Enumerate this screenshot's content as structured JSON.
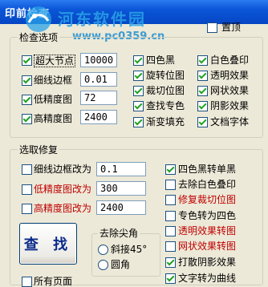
{
  "window": {
    "title": "印前检查"
  },
  "watermark": {
    "name": "河东软件园",
    "url": "www.pc0359.cn"
  },
  "top": {
    "pin_label": "置顶",
    "pin_checked": false
  },
  "check_group": {
    "title": "检查选项",
    "left": [
      {
        "label": "超大节点",
        "checked": true,
        "value": "10000"
      },
      {
        "label": "细线边框",
        "checked": true,
        "value": "0.01"
      },
      {
        "label": "低精度图",
        "checked": true,
        "value": "72"
      },
      {
        "label": "高精度图",
        "checked": true,
        "value": "2400"
      }
    ],
    "middle": [
      {
        "label": "四色黑",
        "checked": true
      },
      {
        "label": "旋转位图",
        "checked": true
      },
      {
        "label": "裁切位图",
        "checked": true
      },
      {
        "label": "查找专色",
        "checked": true
      },
      {
        "label": "渐变填充",
        "checked": true
      }
    ],
    "right": [
      {
        "label": "白色叠印",
        "checked": true
      },
      {
        "label": "透明效果",
        "checked": true
      },
      {
        "label": "网状效果",
        "checked": true
      },
      {
        "label": "阴影效果",
        "checked": true
      },
      {
        "label": "文档字体",
        "checked": true
      }
    ]
  },
  "fix_group": {
    "title": "选取修复",
    "left": [
      {
        "label": "细线边框改为",
        "checked": false,
        "value": "0.1",
        "color": "#000000"
      },
      {
        "label": "低精度图改为",
        "checked": false,
        "value": "300",
        "color": "#C00000"
      },
      {
        "label": "高精度图改为",
        "checked": false,
        "value": "2400",
        "color": "#C00000"
      }
    ],
    "right": [
      {
        "label": "四色黑转单黑",
        "checked": true,
        "color": "#000000"
      },
      {
        "label": "去除白色叠印",
        "checked": false,
        "color": "#000000"
      },
      {
        "label": "修复裁切位图",
        "checked": false,
        "color": "#C00000"
      },
      {
        "label": "专色转为四色",
        "checked": false,
        "color": "#000000"
      },
      {
        "label": "透明效果转图",
        "checked": false,
        "color": "#C00000"
      },
      {
        "label": "网状效果转图",
        "checked": false,
        "color": "#C00000"
      },
      {
        "label": "打散阴影效果",
        "checked": true,
        "color": "#000000"
      },
      {
        "label": "文字转为曲线",
        "checked": true,
        "color": "#000000"
      }
    ],
    "find_button": "查 找",
    "corner_group": {
      "title": "去除尖角",
      "options": [
        {
          "label": "斜接45°",
          "selected": false
        },
        {
          "label": "圆角",
          "selected": false
        }
      ]
    },
    "all_pages": {
      "label": "所有页面",
      "checked": false
    }
  }
}
